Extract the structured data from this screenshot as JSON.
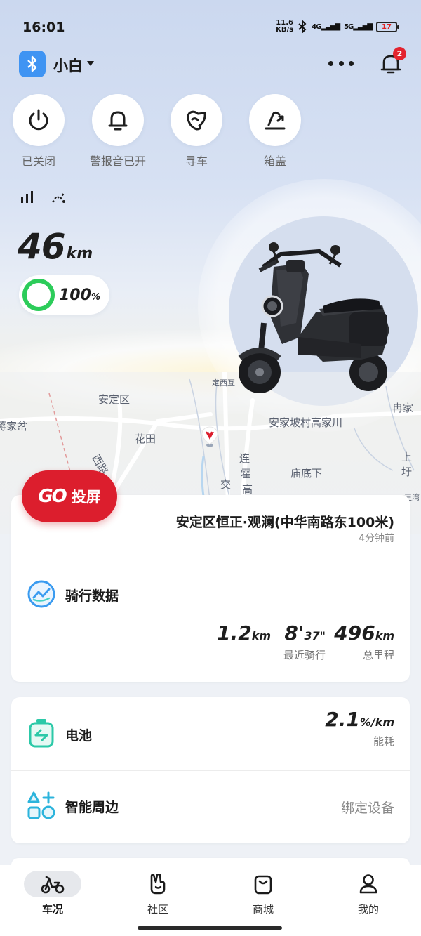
{
  "status_bar": {
    "time": "16:01",
    "net_speed_value": "11.6",
    "net_speed_unit": "KB/s",
    "sim1": "4G",
    "sim2": "5G",
    "battery": "17"
  },
  "header": {
    "vehicle_name": "小白",
    "notification_count": "2"
  },
  "quick_actions": [
    {
      "label": "已关闭",
      "icon": "power-icon"
    },
    {
      "label": "警报音已开",
      "icon": "bell-icon"
    },
    {
      "label": "寻车",
      "icon": "find-car-icon"
    },
    {
      "label": "箱盖",
      "icon": "trunk-lid-icon"
    }
  ],
  "vehicle_status": {
    "range_value": "46",
    "range_unit": "km",
    "battery_percent": "100",
    "battery_unit": "%"
  },
  "map": {
    "labels": [
      "安定区",
      "花田",
      "安家坡村高家川",
      "庙底下",
      "冉家",
      "上圩",
      "连",
      "霍",
      "高",
      "交",
      "西路",
      "定西互",
      "蒋家岔",
      "王湾"
    ]
  },
  "cast": {
    "logo": "GO",
    "label": "投屏"
  },
  "location": {
    "address": "安定区恒正·观澜(中华南路东100米)",
    "time_ago": "4分钟前"
  },
  "ride_data": {
    "title": "骑行数据",
    "recent_distance": "1.2",
    "recent_distance_unit": "km",
    "recent_duration_min": "8'",
    "recent_duration_sec": "37\"",
    "recent_label": "最近骑行",
    "total_distance": "496",
    "total_distance_unit": "km",
    "total_label": "总里程"
  },
  "battery_card": {
    "title": "电池",
    "consumption": "2.1",
    "consumption_unit": "%/km",
    "consumption_label": "能耗"
  },
  "peripherals": {
    "title": "智能周边",
    "action": "绑定设备"
  },
  "bottom_nav": [
    {
      "label": "车况",
      "icon": "scooter-icon",
      "active": true
    },
    {
      "label": "社区",
      "icon": "community-icon",
      "active": false
    },
    {
      "label": "商城",
      "icon": "shop-bag-icon",
      "active": false
    },
    {
      "label": "我的",
      "icon": "profile-icon",
      "active": false
    }
  ],
  "colors": {
    "accent_blue": "#3f94f3",
    "cast_red": "#dc1e2d",
    "battery_green": "#2ccc5a",
    "badge_red": "#e3232f"
  }
}
